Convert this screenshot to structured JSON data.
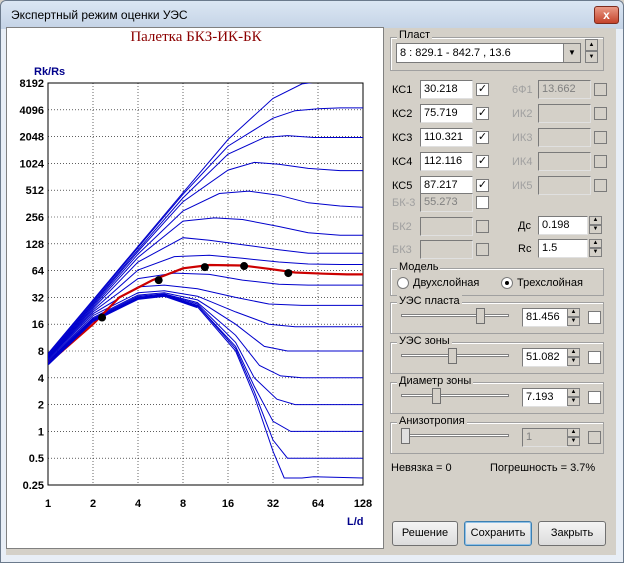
{
  "window": {
    "title": "Экспертный режим оценки УЭС",
    "close_symbol": "x"
  },
  "chart_data": {
    "type": "line",
    "title": "Палетка БКЗ-ИК-БК",
    "ylabel": "Rk/Rs",
    "xlabel": "L/d",
    "xscale": "log2",
    "yscale": "log2",
    "xlim": [
      1,
      128
    ],
    "ylim": [
      0.25,
      8192
    ],
    "x_ticks": [
      "1",
      "2",
      "4",
      "8",
      "16",
      "32",
      "64",
      "128"
    ],
    "y_ticks": [
      "8192",
      "4096",
      "2048",
      "1024",
      "512",
      "256",
      "128",
      "64",
      "32",
      "16",
      "8",
      "4",
      "2",
      "1",
      "0.5",
      "0.25"
    ],
    "grid": true,
    "points": [
      {
        "x": 2.3,
        "y": 19
      },
      {
        "x": 5.5,
        "y": 50
      },
      {
        "x": 11.2,
        "y": 70
      },
      {
        "x": 20.5,
        "y": 72
      },
      {
        "x": 40.5,
        "y": 60
      }
    ],
    "fit_curve": {
      "x": [
        1,
        2,
        3,
        5,
        8,
        12,
        20,
        30,
        45,
        70,
        100,
        128
      ],
      "y": [
        5.8,
        16,
        32,
        50,
        68,
        74,
        73,
        67,
        61,
        59,
        58,
        58
      ]
    },
    "family_curves": [
      {
        "x": [
          1,
          2,
          4,
          8,
          16,
          32,
          50,
          70,
          100,
          128
        ],
        "y": [
          7.5,
          30,
          120,
          480,
          1900,
          5500,
          8000,
          8600,
          8700,
          8700
        ]
      },
      {
        "x": [
          1,
          2,
          4,
          8,
          16,
          32,
          45,
          64,
          90,
          128
        ],
        "y": [
          7.3,
          29,
          116,
          460,
          1600,
          3300,
          4000,
          4200,
          4300,
          4300
        ]
      },
      {
        "x": [
          1,
          2,
          4,
          8,
          16,
          28,
          40,
          60,
          90,
          128
        ],
        "y": [
          7.1,
          28,
          110,
          420,
          1300,
          2000,
          2100,
          2000,
          2000,
          2000
        ]
      },
      {
        "x": [
          1,
          2,
          4,
          8,
          16,
          24,
          35,
          55,
          90,
          128
        ],
        "y": [
          7,
          27,
          105,
          380,
          860,
          1050,
          1000,
          900,
          850,
          850
        ]
      },
      {
        "x": [
          1,
          2,
          4,
          8,
          14,
          22,
          35,
          55,
          90,
          128
        ],
        "y": [
          6.9,
          26,
          98,
          300,
          470,
          500,
          450,
          370,
          340,
          330
        ]
      },
      {
        "x": [
          1,
          2,
          4,
          8,
          13,
          20,
          35,
          55,
          90,
          128
        ],
        "y": [
          6.8,
          25,
          90,
          230,
          250,
          240,
          200,
          170,
          160,
          160
        ]
      },
      {
        "x": [
          1,
          2,
          4,
          8,
          12,
          20,
          35,
          55,
          90,
          128
        ],
        "y": [
          6.7,
          24,
          80,
          150,
          140,
          125,
          110,
          100,
          100,
          100
        ]
      },
      {
        "x": [
          1,
          2,
          4,
          7,
          12,
          20,
          35,
          55,
          90,
          128
        ],
        "y": [
          6.6,
          23,
          65,
          92,
          95,
          88,
          80,
          76,
          75,
          75
        ]
      },
      {
        "x": [
          1,
          2,
          4,
          7,
          12,
          20,
          35,
          55,
          90,
          128
        ],
        "y": [
          6.5,
          22,
          52,
          60,
          58,
          50,
          45,
          44,
          44,
          44
        ]
      },
      {
        "x": [
          1,
          2,
          4,
          6,
          10,
          18,
          30,
          50,
          90,
          128
        ],
        "y": [
          6.3,
          21,
          42,
          44,
          40,
          32,
          27,
          26,
          26,
          26
        ]
      },
      {
        "x": [
          1,
          2,
          4,
          6,
          10,
          18,
          30,
          45,
          70,
          128
        ],
        "y": [
          6.1,
          20,
          36,
          38,
          33,
          22,
          16,
          15,
          15,
          15
        ]
      },
      {
        "x": [
          1,
          2,
          4,
          6,
          10,
          18,
          28,
          40,
          60,
          128
        ],
        "y": [
          6,
          19,
          34,
          36,
          30,
          16,
          9,
          8,
          8,
          8
        ]
      },
      {
        "x": [
          1,
          2,
          4,
          6,
          10,
          18,
          26,
          36,
          50,
          128
        ],
        "y": [
          5.9,
          18.5,
          33,
          35,
          28,
          12,
          5.5,
          4.2,
          4,
          4
        ]
      },
      {
        "x": [
          1,
          2,
          4,
          6,
          10,
          18,
          24,
          34,
          45,
          128
        ],
        "y": [
          5.8,
          18,
          32,
          34.5,
          27,
          10,
          4,
          2.3,
          2,
          2
        ]
      },
      {
        "x": [
          1,
          2,
          4,
          6,
          10,
          18,
          24,
          32,
          42,
          128
        ],
        "y": [
          5.8,
          18,
          32,
          34,
          26,
          9,
          3.2,
          1.3,
          1,
          1
        ]
      },
      {
        "x": [
          1,
          2,
          4,
          6,
          10,
          18,
          24,
          32,
          40,
          128
        ],
        "y": [
          5.7,
          17.5,
          31.5,
          34,
          26,
          8.5,
          2.8,
          0.8,
          0.5,
          0.5
        ]
      },
      {
        "x": [
          1,
          2,
          4,
          6,
          10,
          18,
          24,
          32,
          38,
          50,
          60,
          128
        ],
        "y": [
          5.7,
          17.5,
          31,
          33.5,
          25,
          8,
          2.5,
          0.6,
          0.3,
          0.3,
          0.31,
          0.3
        ]
      }
    ],
    "colors": {
      "family": "#0000cc",
      "fit": "#cc0000",
      "points": "#000000",
      "grid": "#000000"
    }
  },
  "sidebar": {
    "plast_label": "Пласт",
    "plast_value": "8 : 829.1 - 842.7 , 13.6",
    "ks": [
      {
        "label": "КС1",
        "value": "30.218",
        "checked": "✓"
      },
      {
        "label": "КС2",
        "value": "75.719",
        "checked": "✓"
      },
      {
        "label": "КС3",
        "value": "110.321",
        "checked": "✓"
      },
      {
        "label": "КС4",
        "value": "112.116",
        "checked": "✓"
      },
      {
        "label": "КС5",
        "value": "87.217",
        "checked": "✓"
      }
    ],
    "ik": [
      {
        "label": "6Ф1",
        "value": "13.662"
      },
      {
        "label": "ИК2",
        "value": ""
      },
      {
        "label": "ИК3",
        "value": ""
      },
      {
        "label": "ИК4",
        "value": ""
      },
      {
        "label": "ИК5",
        "value": ""
      }
    ],
    "bk": [
      {
        "label": "БК-3",
        "value": "55.273"
      },
      {
        "label": "БК2",
        "value": ""
      },
      {
        "label": "БК3",
        "value": ""
      }
    ],
    "dc_label": "Дс",
    "dc_value": "0.198",
    "rc_label": "Rc",
    "rc_value": "1.5",
    "model_label": "Модель",
    "model_opt1": "Двухслойная",
    "model_opt2": "Трехслойная",
    "uesp_label": "УЭС пласта",
    "uesp_value": "81.456",
    "uesp_level": 0.72,
    "uesz_label": "УЭС зоны",
    "uesz_value": "51.082",
    "uesz_level": 0.45,
    "dz_label": "Диаметр зоны",
    "dz_value": "7.193",
    "dz_level": 0.3,
    "aniz_label": "Анизотропия",
    "aniz_value": "1",
    "aniz_level": 0.0,
    "nevyazka": "Невязка = 0",
    "pogreshnost": "Погрешность = 3.7%",
    "btn_solve": "Решение",
    "btn_save": "Сохранить",
    "btn_close": "Закрыть"
  }
}
